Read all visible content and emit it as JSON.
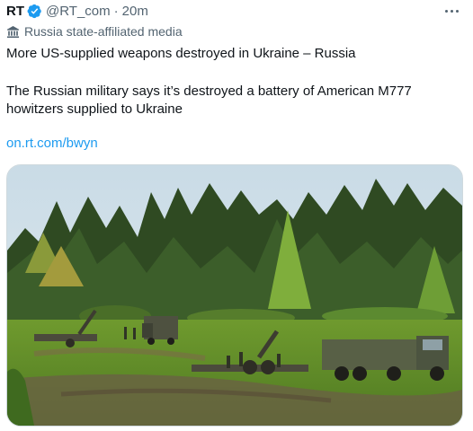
{
  "tweet": {
    "author_name": "RT",
    "verified_icon": "verified-badge-icon",
    "handle": "@RT_com",
    "separator": "·",
    "time": "20m",
    "more_icon": "more-options-icon",
    "label_icon": "building-icon",
    "label": "Russia state-affiliated media",
    "text_line1": "More US-supplied weapons destroyed in Ukraine – Russia",
    "text_line2": "The Russian military says it’s destroyed a battery of American M777",
    "text_line3": "howitzers supplied to Ukraine",
    "link": "on.rt.com/bwyn"
  },
  "colors": {
    "text": "#0f1419",
    "secondary": "#536471",
    "link": "#1d9bf0",
    "verified": "#1d9bf0",
    "border": "#cfd9de"
  }
}
